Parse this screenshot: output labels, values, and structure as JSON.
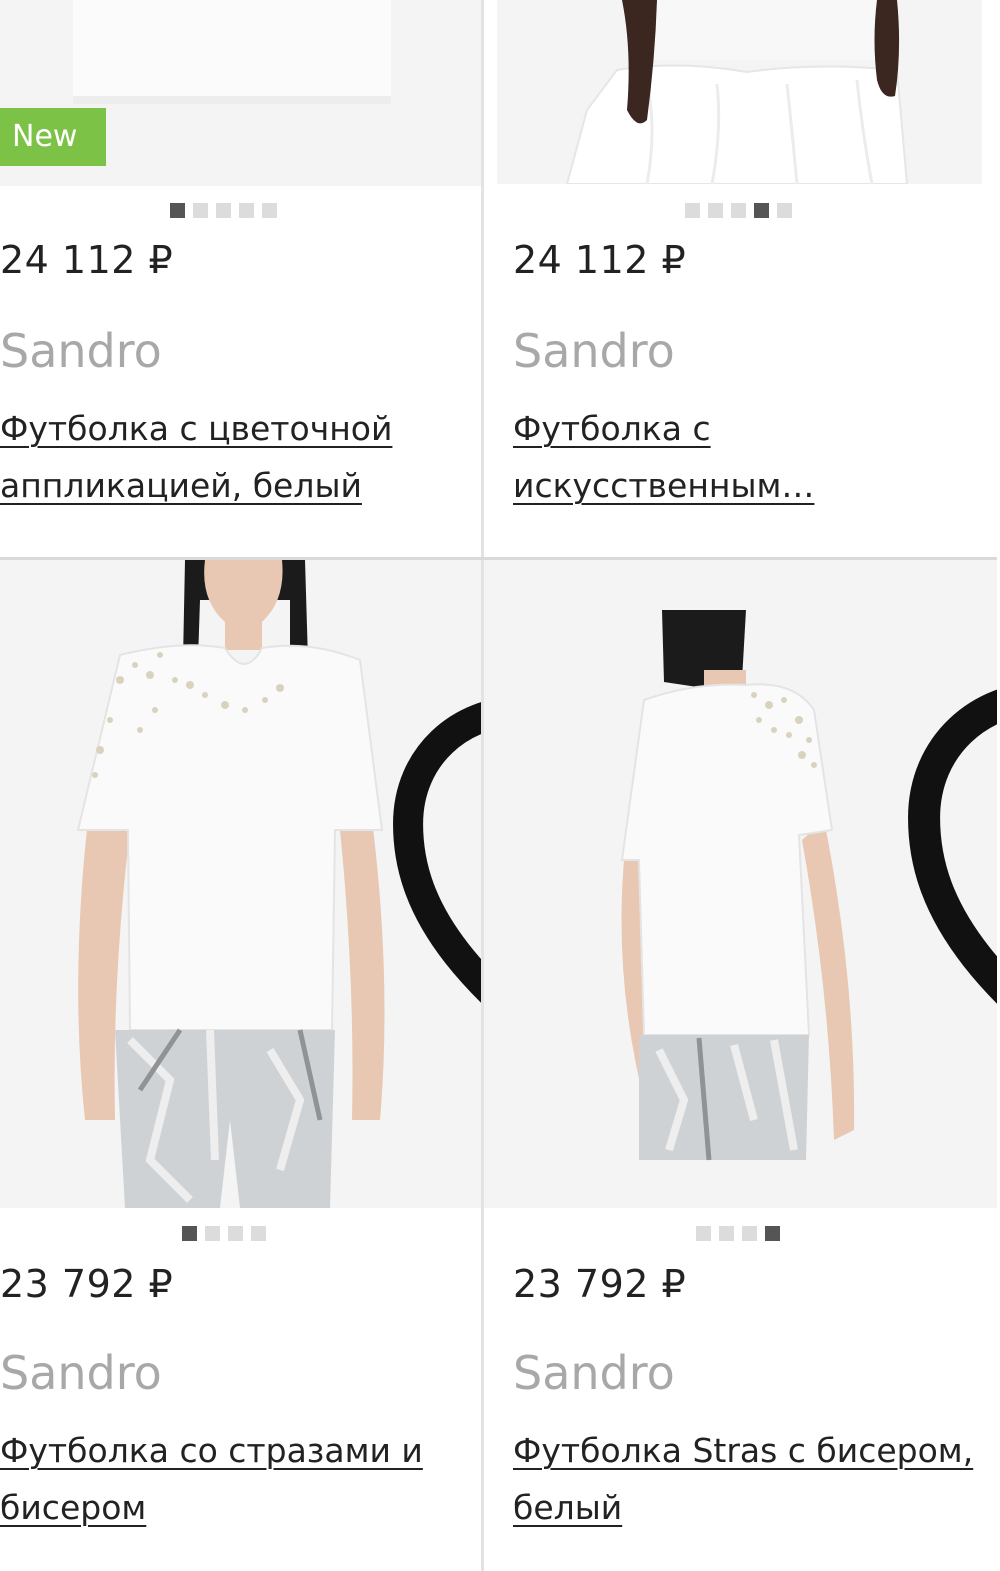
{
  "products": [
    {
      "badge": "New",
      "price": "24 112 ₽",
      "brand": "Sandro",
      "title": "Футболка с цветочной аппликацией, белый",
      "image": "white-tshirt-folded",
      "favorite_icon": "heart-outline-icon",
      "carousel": {
        "count": 5,
        "active": 1
      }
    },
    {
      "price": "24 112 ₽",
      "brand": "Sandro",
      "title": "Футболка с искусственным…",
      "image": "white-ruffled-dress",
      "favorite_icon": "heart-outline-icon",
      "carousel": {
        "count": 5,
        "active": 4
      }
    },
    {
      "price": "23 792 ₽",
      "brand": "Sandro",
      "title": "Футболка со стразами и бисером",
      "image": "model-front-white-tshirt-silver-trousers",
      "favorite_icon": "heart-outline-icon",
      "carousel": {
        "count": 4,
        "active": 1
      }
    },
    {
      "price": "23 792 ₽",
      "brand": "Sandro",
      "title": "Футболка Stras с бисером, белый",
      "image": "model-back-white-tshirt-silver-trousers",
      "favorite_icon": "heart-outline-icon",
      "carousel": {
        "count": 4,
        "active": 4
      }
    }
  ],
  "colors": {
    "badge_new": "#7cc247",
    "price": "#222222",
    "brand": "#a8a8a8",
    "dot_active": "#555555",
    "dot_inactive": "#dcdcdc"
  }
}
